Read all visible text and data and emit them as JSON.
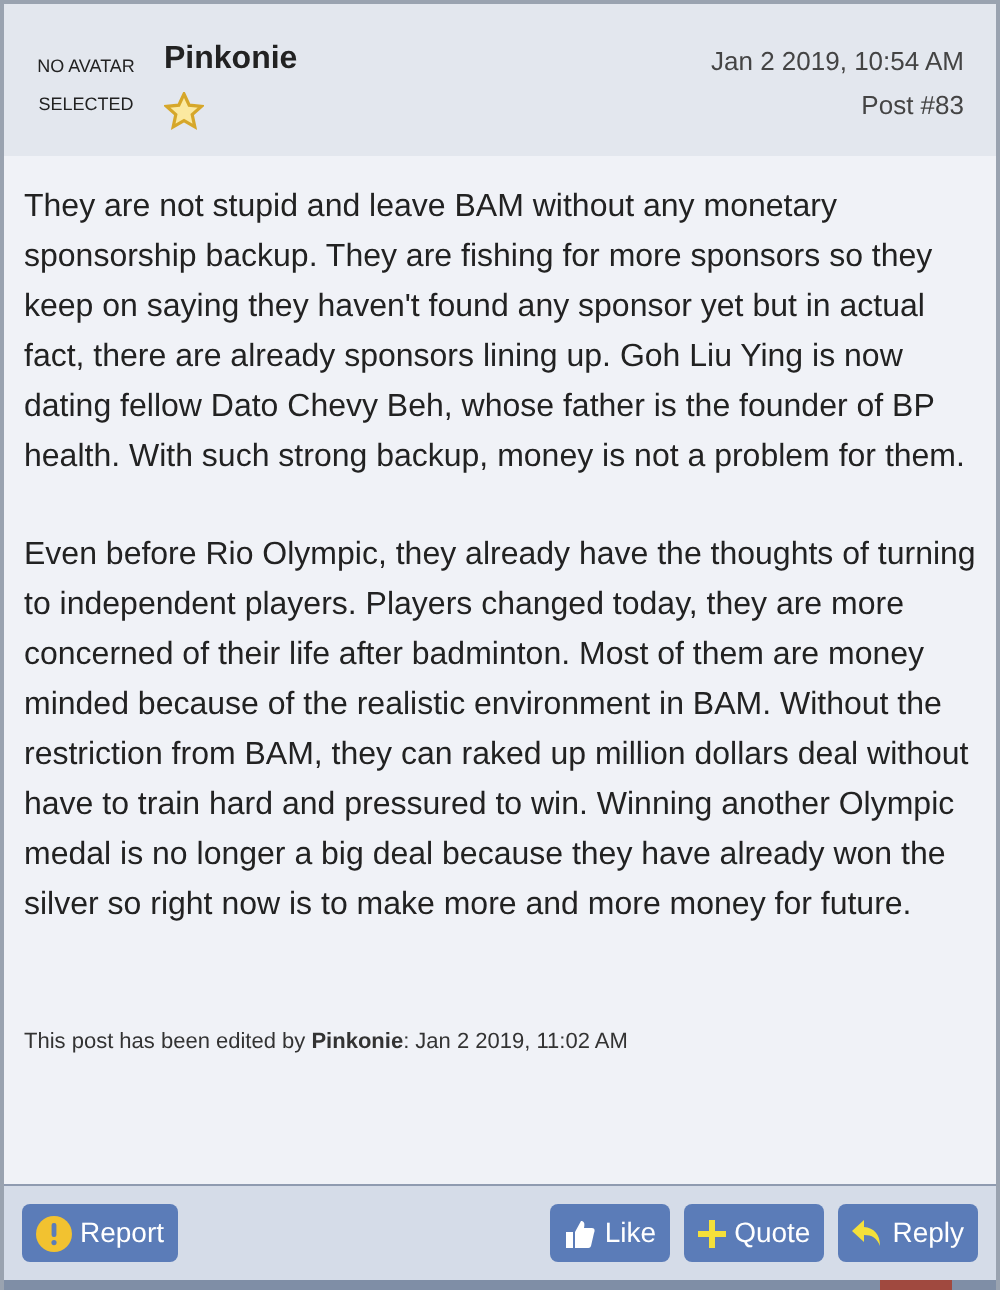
{
  "post": {
    "avatar_text": "NO AVATAR SELECTED",
    "author": "Pinkonie",
    "date": "Jan 2 2019, 10:54 AM",
    "number": "Post #83",
    "paragraphs": [
      "They are not stupid and leave BAM without any monetary sponsorship backup. They are fishing for more sponsors so they keep on saying they haven't found any sponsor yet but in actual fact, there are already sponsors lining up. Goh Liu Ying is now dating fellow Dato Chevy Beh, whose father is the founder of BP health. With such strong backup, money is not a problem for them.",
      "Even before Rio Olympic, they already have the thoughts of turning to independent players. Players changed today, they are more concerned of their life after badminton. Most of them are money minded because of the realistic environment in BAM. Without the restriction from BAM, they can raked up million dollars deal without have to train hard and pressured to win. Winning another Olympic medal is no longer a big deal because they have already won the silver so right now is to make more and more money for future."
    ],
    "edit_note": "This post has been edited by **Pinkonie**: Jan 2 2019, 11:02 AM"
  },
  "buttons": [
    {
      "kind": "report",
      "label": "Report"
    },
    {
      "kind": "like",
      "label": "Like"
    },
    {
      "kind": "quote",
      "label": "Quote"
    },
    {
      "kind": "reply",
      "label": "Reply"
    }
  ]
}
